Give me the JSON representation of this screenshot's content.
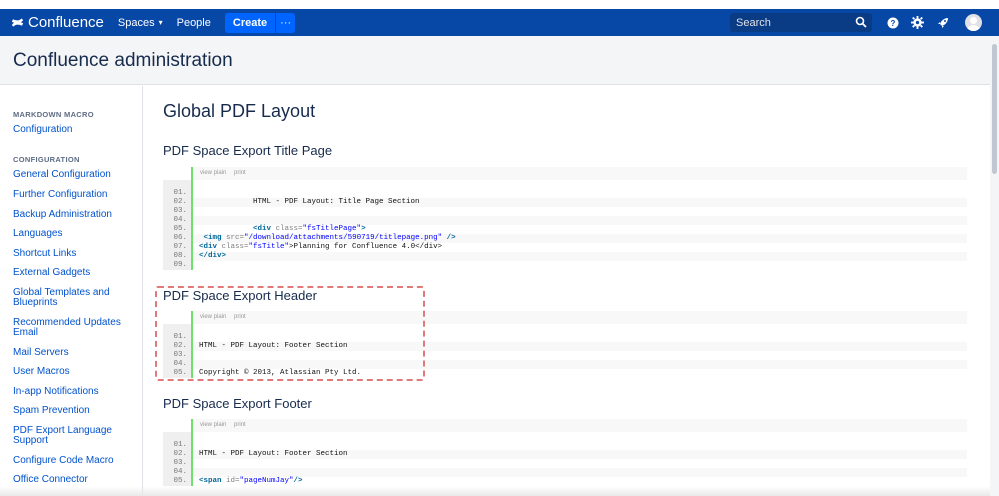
{
  "topbar": {
    "brand": "Confluence",
    "spaces_label": "Spaces",
    "people_label": "People",
    "create_label": "Create",
    "more_label": "···",
    "search_placeholder": "Search"
  },
  "header": {
    "title": "Confluence administration"
  },
  "sidebar": {
    "sections": [
      {
        "heading": "MARKDOWN MACRO",
        "items": [
          "Configuration"
        ]
      },
      {
        "heading": "CONFIGURATION",
        "items": [
          "General Configuration",
          "Further Configuration",
          "Backup Administration",
          "Languages",
          "Shortcut Links",
          "External Gadgets",
          "Global Templates and Blueprints",
          "Recommended Updates Email",
          "Mail Servers",
          "User Macros",
          "In-app Notifications",
          "Spam Prevention",
          "PDF Export Language Support",
          "Configure Code Macro",
          "Office Connector"
        ]
      }
    ]
  },
  "main": {
    "page_title": "Global PDF Layout",
    "sections": [
      {
        "title": "PDF Space Export Title Page",
        "toolbar": [
          "view plain",
          "print"
        ],
        "lines": [
          {
            "n": "01.",
            "text": ""
          },
          {
            "n": "02.",
            "text": "            HTML - PDF Layout: Title Page Section"
          },
          {
            "n": "03.",
            "text": ""
          },
          {
            "n": "04.",
            "text": ""
          },
          {
            "n": "05.",
            "pre": "            ",
            "tag": "<div ",
            "attr": "class=",
            "str": "\"fsTitlePage\"",
            "post": ">"
          },
          {
            "n": "06.",
            "pre": " ",
            "tag": "<img ",
            "attr": "src=",
            "str": "\"/download/attachments/590719/titlepage.png\"",
            "post": " />"
          },
          {
            "n": "07.",
            "pre": "",
            "tag": "<div ",
            "attr": "class=",
            "str": "\"fsTitle\"",
            "post": ">Planning for Confluence 4.0</div>"
          },
          {
            "n": "08.",
            "pre": "",
            "tag": "</div>",
            "attr": "",
            "str": "",
            "post": ""
          },
          {
            "n": "09.",
            "text": ""
          }
        ]
      },
      {
        "title": "PDF Space Export Header",
        "toolbar": [
          "view plain",
          "print"
        ],
        "lines": [
          {
            "n": "01.",
            "text": ""
          },
          {
            "n": "02.",
            "text": "HTML - PDF Layout: Footer Section"
          },
          {
            "n": "03.",
            "text": ""
          },
          {
            "n": "04.",
            "text": ""
          },
          {
            "n": "05.",
            "text": "Copyright © 2013, Atlassian Pty Ltd."
          }
        ]
      },
      {
        "title": "PDF Space Export Footer",
        "toolbar": [
          "view plain",
          "print"
        ],
        "lines": [
          {
            "n": "01.",
            "text": ""
          },
          {
            "n": "02.",
            "text": "HTML - PDF Layout: Footer Section"
          },
          {
            "n": "03.",
            "text": ""
          },
          {
            "n": "04.",
            "text": ""
          },
          {
            "n": "05.",
            "pre": "",
            "tag": "<span ",
            "attr": "id=",
            "str": "\"pageNumJay\"",
            "post": "/>"
          }
        ]
      }
    ]
  },
  "colors": {
    "topbar": "#0747a6",
    "create_button": "#0065ff",
    "link": "#0052cc",
    "highlight_border": "#e07a7a",
    "code_gutter_line": "#6ce26c"
  }
}
